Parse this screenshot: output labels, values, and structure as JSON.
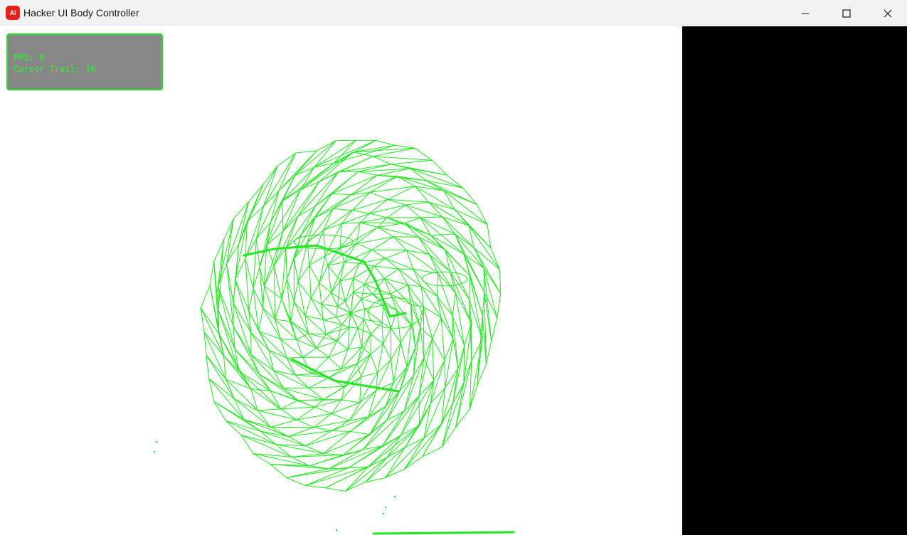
{
  "window": {
    "title": "Hacker UI Body Controller",
    "icon_text": "Ai",
    "icon_color": "#e8201b",
    "controls": [
      "minimize-icon",
      "maximize-icon",
      "close-icon"
    ]
  },
  "hud": {
    "fps_text": "FPS: 9",
    "trail_text": "Cursor Trail: 16",
    "text_color": "#22ff22",
    "border_color": "#22e022",
    "background": "#878787"
  },
  "colors": {
    "mesh": "#22e622",
    "canvas": "#ffffff",
    "side_panel": "#000000",
    "particles": "#00bfff"
  }
}
